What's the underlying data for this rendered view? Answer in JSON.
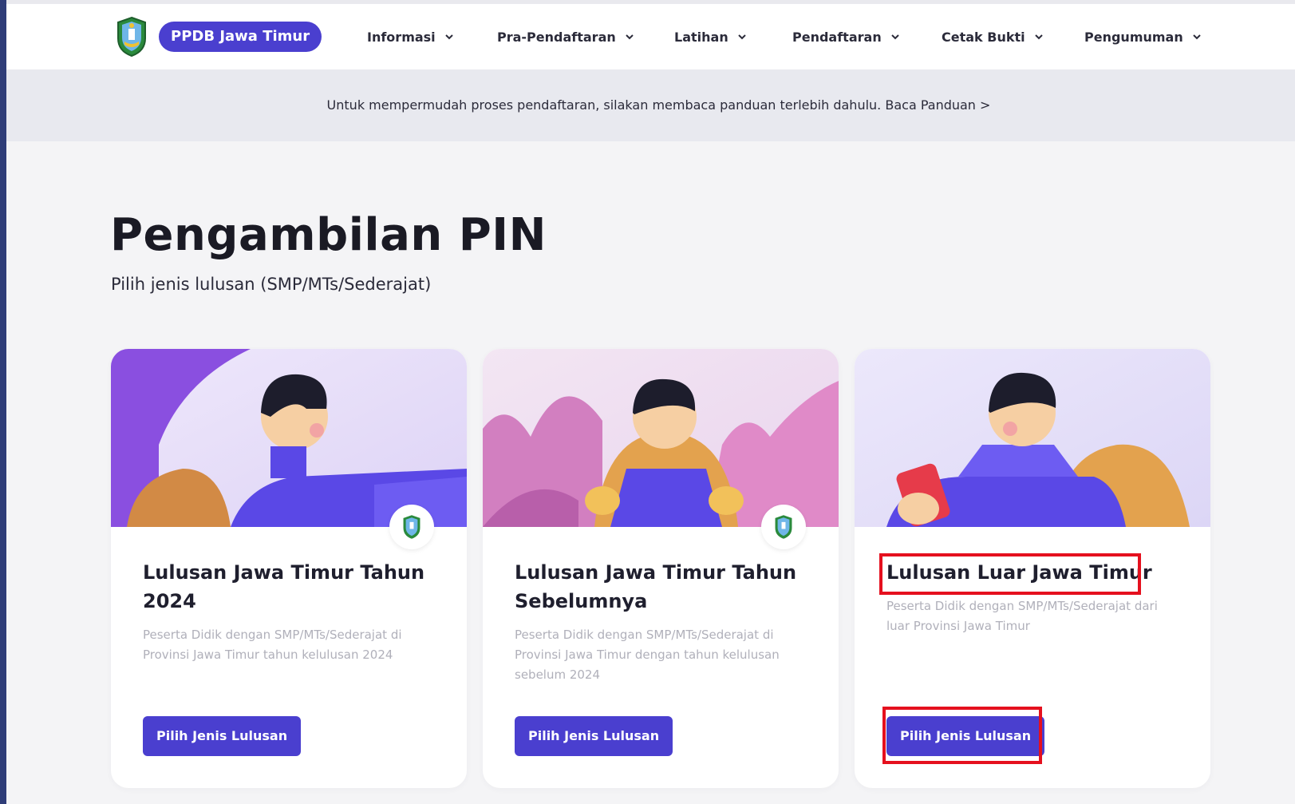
{
  "brand": {
    "name": "PPDB Jawa Timur"
  },
  "nav": {
    "items": [
      {
        "label": "Informasi"
      },
      {
        "label": "Pra-Pendaftaran"
      },
      {
        "label": "Latihan"
      },
      {
        "label": "Pendaftaran"
      },
      {
        "label": "Cetak Bukti"
      },
      {
        "label": "Pengumuman"
      }
    ]
  },
  "banner": {
    "text": "Untuk mempermudah proses pendaftaran, silakan membaca panduan terlebih dahulu.",
    "link": "Baca Panduan >"
  },
  "page": {
    "title": "Pengambilan PIN",
    "subtitle": "Pilih jenis lulusan (SMP/MTs/Sederajat)"
  },
  "cards": [
    {
      "title": "Lulusan Jawa Timur Tahun 2024",
      "desc": "Peserta Didik dengan SMP/MTs/Sederajat di Provinsi Jawa Timur tahun kelulusan 2024",
      "button": "Pilih Jenis Lulusan"
    },
    {
      "title": "Lulusan Jawa Timur Tahun Sebelumnya",
      "desc": "Peserta Didik dengan SMP/MTs/Sederajat di Provinsi Jawa Timur dengan tahun kelulusan sebelum 2024",
      "button": "Pilih Jenis Lulusan"
    },
    {
      "title": "Lulusan Luar Jawa Timur",
      "desc": "Peserta Didik dengan SMP/MTs/Sederajat dari luar Provinsi Jawa Timur",
      "button": "Pilih Jenis Lulusan"
    }
  ],
  "colors": {
    "primary": "#4a3fcf",
    "highlight": "#e5101e",
    "background": "#f4f4f6",
    "banner": "#e8e9ef"
  }
}
